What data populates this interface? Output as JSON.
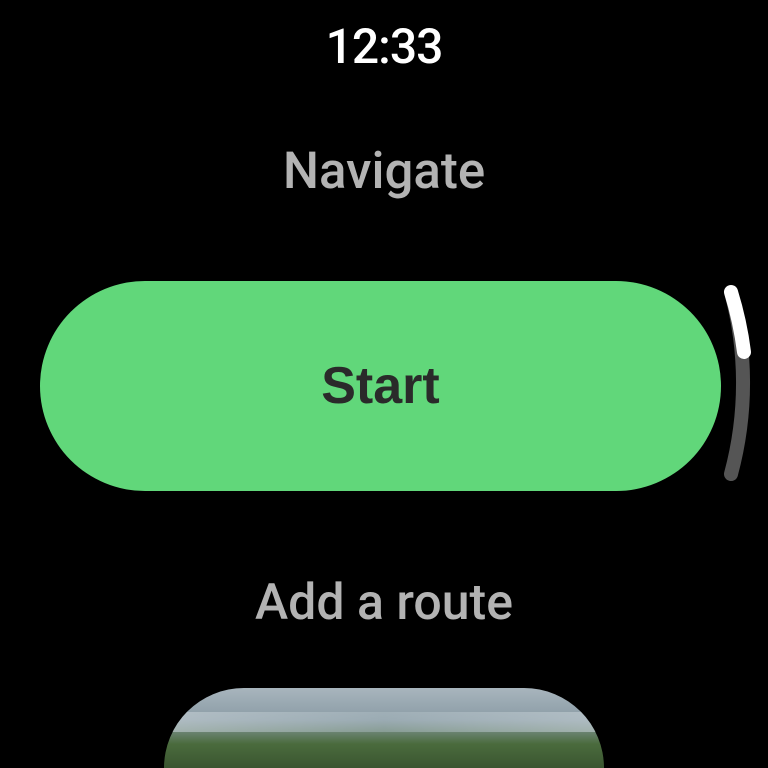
{
  "statusBar": {
    "time": "12:33"
  },
  "header": {
    "title": "Navigate"
  },
  "main": {
    "start_label": "Start"
  },
  "secondary": {
    "add_route_label": "Add a route"
  },
  "colors": {
    "background": "#000000",
    "primary_button": "#61d77a",
    "text_primary": "#ffffff",
    "text_secondary": "#b3b3b3",
    "button_text": "#2a2a2a"
  }
}
